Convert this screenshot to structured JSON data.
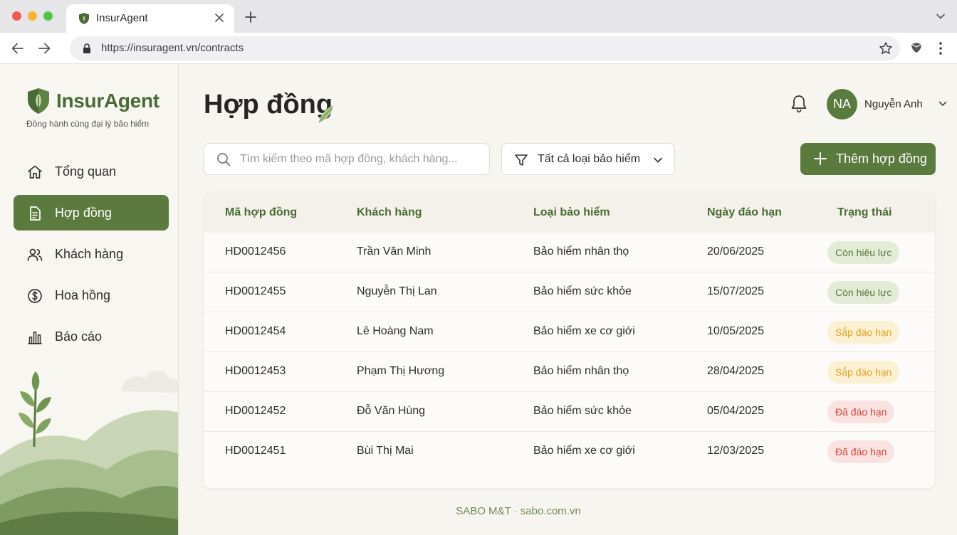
{
  "browser": {
    "tab_title": "InsurAgent",
    "url": "https://insuragent.vn/contracts"
  },
  "sidebar": {
    "brand": "InsurAgent",
    "tagline": "Đồng hành cùng đại lý bảo hiểm",
    "items": [
      {
        "label": "Tổng quan",
        "icon": "home-icon",
        "active": false
      },
      {
        "label": "Hợp đồng",
        "icon": "document-icon",
        "active": true
      },
      {
        "label": "Khách hàng",
        "icon": "users-icon",
        "active": false
      },
      {
        "label": "Hoa hồng",
        "icon": "dollar-icon",
        "active": false
      },
      {
        "label": "Báo cáo",
        "icon": "bar-chart-icon",
        "active": false
      }
    ]
  },
  "header": {
    "title": "Hợp đồng",
    "user_initials": "NA",
    "user_name": "Nguyễn Anh"
  },
  "toolbar": {
    "search_placeholder": "Tìm kiếm theo mã hợp đồng, khách hàng...",
    "search_value": "",
    "filter_label": "Tất cả loại bảo hiểm",
    "add_label": "Thêm hợp đồng"
  },
  "table": {
    "columns": [
      "Mã hợp đồng",
      "Khách hàng",
      "Loại bảo hiểm",
      "Ngày đáo hạn",
      "Trạng thái"
    ],
    "rows": [
      {
        "id": "HD0012456",
        "customer": "Trần Văn Minh",
        "type": "Bảo hiểm nhân thọ",
        "due": "20/06/2025",
        "status": "Còn hiệu lực",
        "status_kind": "active"
      },
      {
        "id": "HD0012455",
        "customer": "Nguyễn Thị Lan",
        "type": "Bảo hiểm sức khỏe",
        "due": "15/07/2025",
        "status": "Còn hiệu lực",
        "status_kind": "active"
      },
      {
        "id": "HD0012454",
        "customer": "Lê Hoàng Nam",
        "type": "Bảo hiểm xe cơ giới",
        "due": "10/05/2025",
        "status": "Sắp đáo hạn",
        "status_kind": "expiring"
      },
      {
        "id": "HD0012453",
        "customer": "Phạm Thị Hương",
        "type": "Bảo hiểm nhân thọ",
        "due": "28/04/2025",
        "status": "Sắp đáo hạn",
        "status_kind": "expiring"
      },
      {
        "id": "HD0012452",
        "customer": "Đỗ Văn Hùng",
        "type": "Bảo hiểm sức khỏe",
        "due": "05/04/2025",
        "status": "Đã đáo hạn",
        "status_kind": "expired"
      },
      {
        "id": "HD0012451",
        "customer": "Bùi Thị Mai",
        "type": "Bảo hiểm xe cơ giới",
        "due": "12/03/2025",
        "status": "Đã đáo hạn",
        "status_kind": "expired"
      }
    ]
  },
  "footer": {
    "text": "SABO M&T · sabo.com.vn"
  },
  "colors": {
    "brand_green": "#5a7a3e",
    "status_active": "#5a7a3e",
    "status_expiring": "#e0a324",
    "status_expired": "#d2443d"
  }
}
